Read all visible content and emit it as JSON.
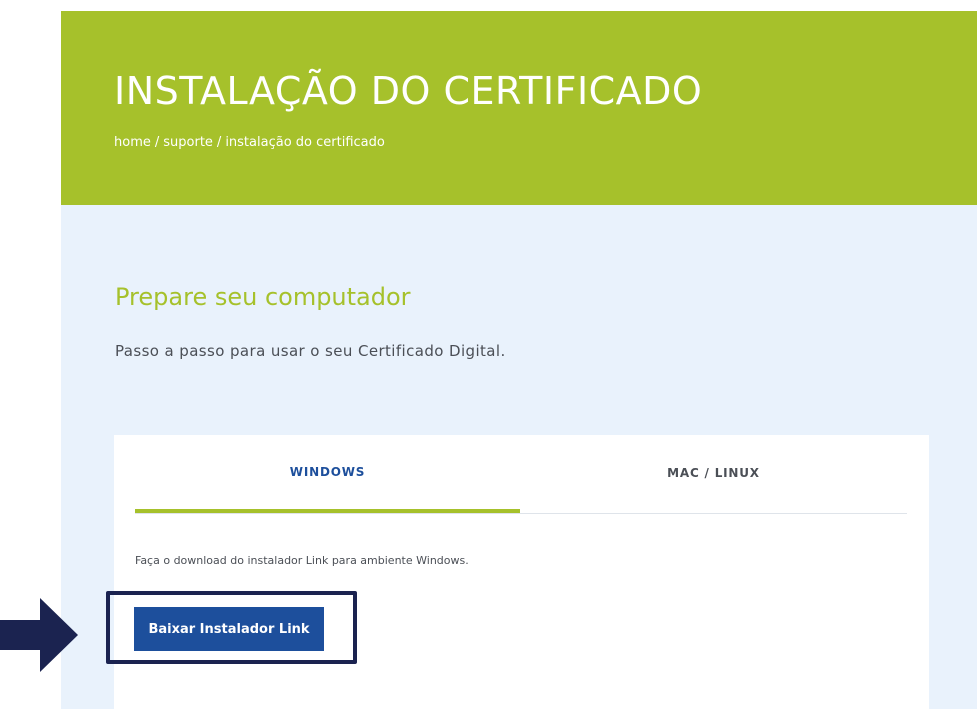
{
  "hero": {
    "title": "INSTALAÇÃO DO CERTIFICADO",
    "breadcrumb": [
      {
        "label": "home"
      },
      {
        "label": "suporte"
      },
      {
        "label": "instalação do certificado"
      }
    ],
    "separator": "/"
  },
  "section": {
    "title": "Prepare seu computador",
    "description": "Passo a passo para usar o seu Certificado Digital."
  },
  "tabs": [
    {
      "label": "WINDOWS",
      "active": true
    },
    {
      "label": "MAC / LINUX",
      "active": false
    }
  ],
  "panel": {
    "text": "Faça o download do instalador Link para ambiente Windows.",
    "button_label": "Baixar Instalador Link"
  },
  "annotation": {
    "arrow_icon": "arrow-right-icon",
    "highlight_color": "#1b2350"
  },
  "colors": {
    "brand_green": "#a6c12b",
    "brand_blue": "#1d4f9c",
    "page_bg": "#e9f2fc"
  }
}
